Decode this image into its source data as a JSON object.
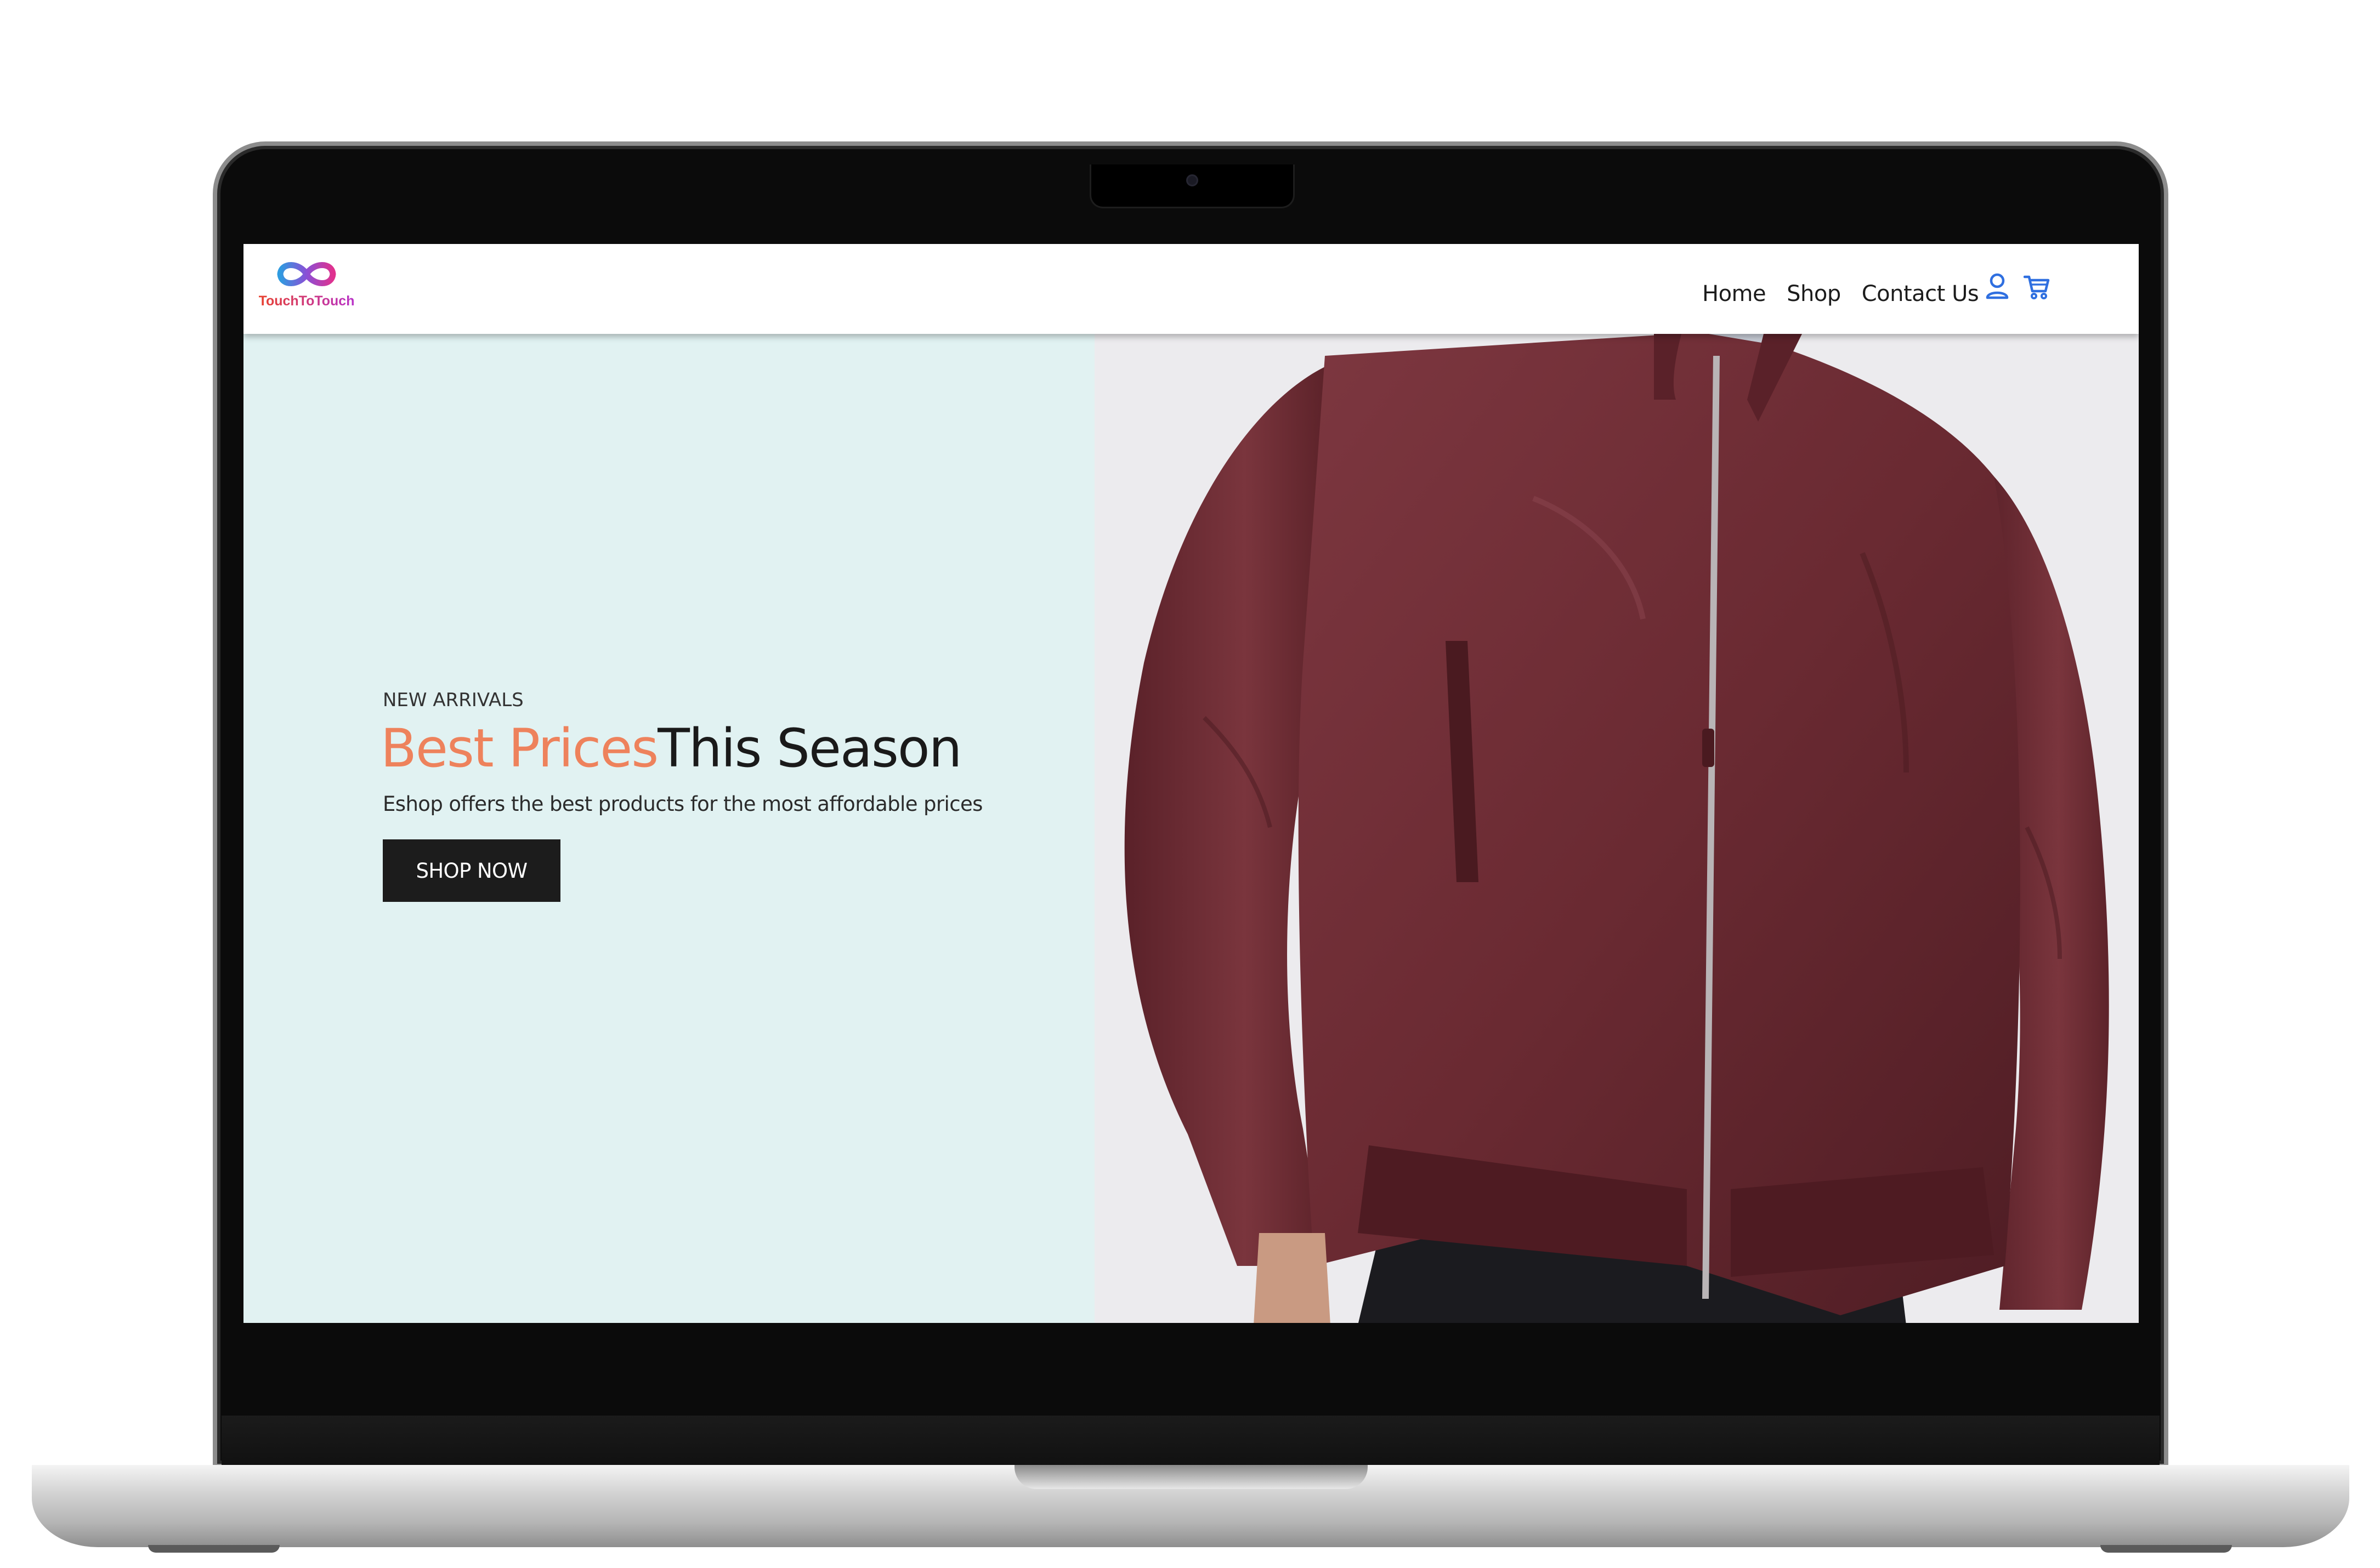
{
  "brand": {
    "name": "TouchToTouch",
    "logo_icon": "infinity-icon",
    "colors": {
      "gradient_start": "#e8402e",
      "gradient_end": "#b832c8",
      "icon_blue": "#2f6fe0"
    }
  },
  "nav": {
    "links": [
      {
        "label": "Home"
      },
      {
        "label": "Shop"
      },
      {
        "label": "Contact Us"
      }
    ],
    "icons": [
      "user-icon",
      "cart-icon"
    ],
    "icon_color": "#2f6fe0"
  },
  "hero": {
    "eyebrow": "NEW ARRIVALS",
    "headline_accent": "Best Prices",
    "headline_rest": "This Season",
    "subtext": "Eshop offers the best products for the most affordable prices",
    "cta_label": "SHOP NOW",
    "accent_color": "#ee825c",
    "panel_color": "#e1f2f2",
    "image": "man-in-burgundy-bomber-jacket"
  }
}
